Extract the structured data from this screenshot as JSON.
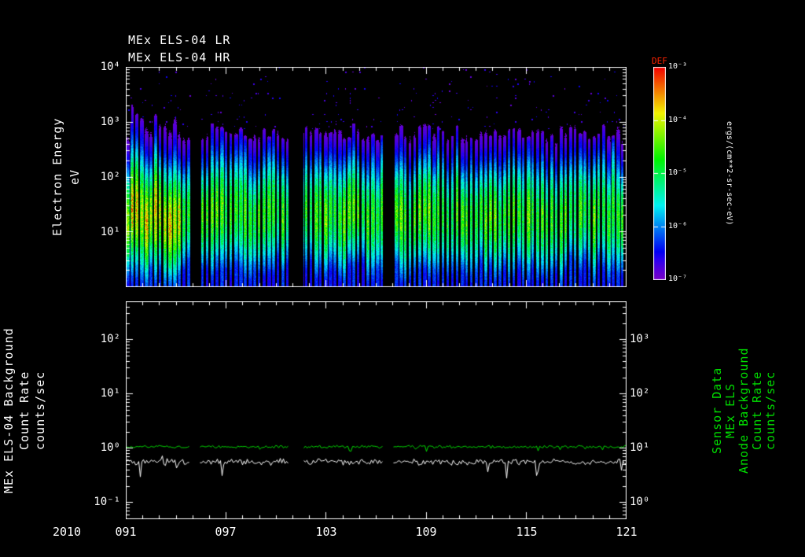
{
  "figure": {
    "title_lr": "MEx ELS-04 LR",
    "title_hr": "MEx ELS-04 HR",
    "year": "2010",
    "background": "#000000",
    "accent_green": "#00dd00",
    "accent_red": "#ff2200",
    "frame_color": "#ffffff"
  },
  "chart_data": [
    {
      "type": "heatmap",
      "name": "electron-energy-spectrogram",
      "ylabel": "Electron Energy",
      "ylabel_units": "eV",
      "ylim_log_ev": [
        0,
        4
      ],
      "yticks": [
        "10⁴",
        "10³",
        "10²",
        "10¹"
      ],
      "x_days": [
        91,
        121
      ],
      "xticks": [
        "091",
        "097",
        "103",
        "109",
        "115",
        "121"
      ],
      "xtick_days": [
        91,
        97,
        103,
        109,
        115,
        121
      ],
      "gaps_days": [
        [
          94.85,
          95.35
        ],
        [
          100.8,
          101.6
        ],
        [
          106.4,
          107.0
        ]
      ],
      "enhanced_interval_days": [
        91.3,
        94.3
      ],
      "band": {
        "peak_center_log_ev": 1.3,
        "peak_width_log": 0.6,
        "upper_cutoff_log_ev": 2.75,
        "low_tail_log_ev": 0.8
      },
      "colorbar": {
        "label": "DEF",
        "units": "ergs/(cm**2-sr-sec-eV)",
        "ticks": [
          "10⁻³",
          "10⁻⁴",
          "10⁻⁵",
          "10⁻⁶",
          "10⁻⁷"
        ],
        "range_log": [
          -7,
          -3
        ]
      }
    },
    {
      "type": "line",
      "name": "background-count-rates",
      "x_days": [
        91,
        121
      ],
      "gaps_days": [
        [
          94.85,
          95.35
        ],
        [
          100.8,
          101.6
        ],
        [
          106.4,
          107.0
        ]
      ],
      "left_axis": {
        "label_lines": [
          "MEx ELS-04 Background",
          "Count Rate",
          "counts/sec"
        ],
        "ticks": [
          "10²",
          "10¹",
          "10⁰",
          "10⁻¹"
        ],
        "range_log": [
          -1.3,
          2.7
        ]
      },
      "right_axis": {
        "label_lines": [
          "Sensor Data",
          "MEx ELS",
          "Anode Background",
          "Count Rate",
          "counts/sec"
        ],
        "ticks": [
          "10³",
          "10²",
          "10¹",
          "10⁰"
        ],
        "range_log": [
          -0.3,
          3.7
        ]
      },
      "series": [
        {
          "name": "els04-background-count-rate",
          "color": "#ffffff",
          "mean_log10": -0.26,
          "noise_log10": 0.07,
          "spike_log10": 0.45
        },
        {
          "name": "els-anode-background-count-rate",
          "color": "#00dd00",
          "mean_log10": 0.02,
          "noise_log10": 0.03,
          "spike_log10": 0.12
        }
      ]
    }
  ]
}
